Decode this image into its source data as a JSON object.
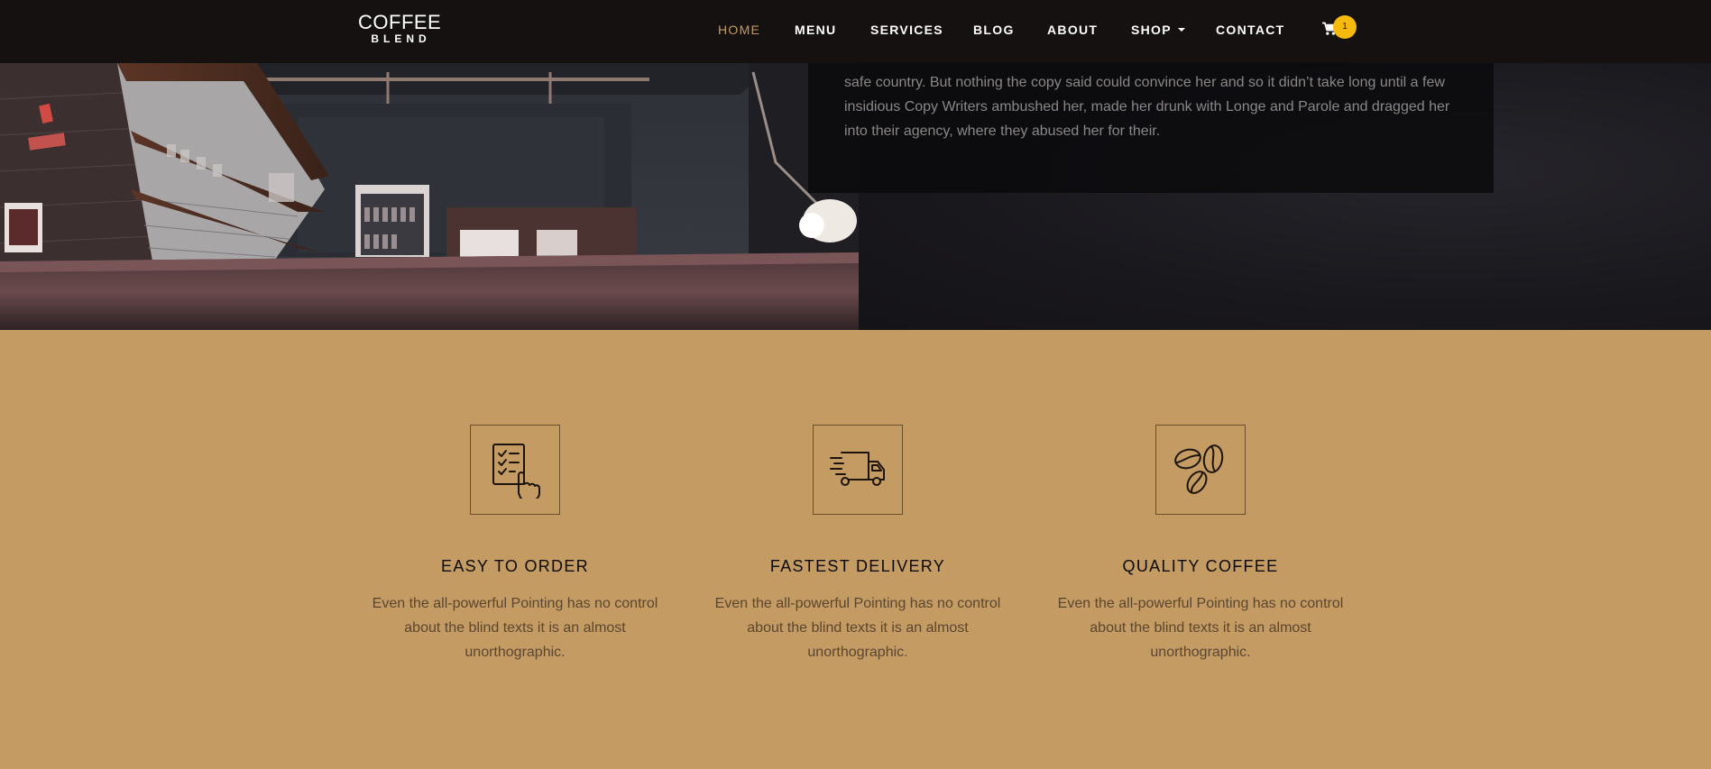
{
  "brand": {
    "line1": "COFFEE",
    "line2": "BLEND"
  },
  "nav": {
    "items": [
      {
        "label": "HOME",
        "active": true
      },
      {
        "label": "MENU"
      },
      {
        "label": "SERVICES"
      },
      {
        "label": "BLOG"
      },
      {
        "label": "ABOUT"
      },
      {
        "label": "SHOP",
        "dropdown": true
      },
      {
        "label": "CONTACT"
      }
    ],
    "cart_count": "1"
  },
  "about": {
    "text": "safe country. But nothing the copy said could convince her and so it didn’t take long until a few insidious Copy Writers ambushed her, made her drunk with Longe and Parole and dragged her into their agency, where they abused her for their."
  },
  "features": [
    {
      "icon": "order-checklist-icon",
      "title": "EASY TO ORDER",
      "text": "Even the all-powerful Pointing has no control about the blind texts it is an almost unorthographic."
    },
    {
      "icon": "delivery-truck-icon",
      "title": "FASTEST DELIVERY",
      "text": "Even the all-powerful Pointing has no control about the blind texts it is an almost unorthographic."
    },
    {
      "icon": "coffee-beans-icon",
      "title": "QUALITY COFFEE",
      "text": "Even the all-powerful Pointing has no control about the blind texts it is an almost unorthographic."
    }
  ],
  "colors": {
    "accent": "#c49b63",
    "navbar_bg": "#151111",
    "badge": "#f6b90d"
  }
}
